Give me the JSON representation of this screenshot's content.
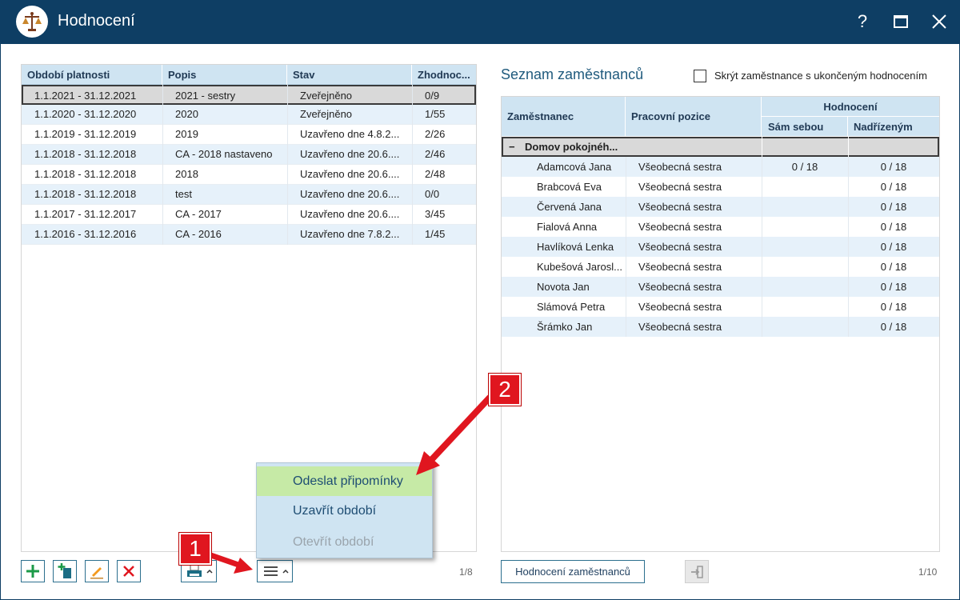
{
  "window": {
    "title": "Hodnocení",
    "help_glyph": "?",
    "logo_icon": "scales-of-justice-icon"
  },
  "left_grid": {
    "columns": [
      "Období platnosti",
      "Popis",
      "Stav",
      "Zhodnoc..."
    ],
    "rows": [
      {
        "period": "1.1.2021 - 31.12.2021",
        "desc": "2021 - sestry",
        "state": "Zveřejněno",
        "eval": "0/9",
        "selected": true
      },
      {
        "period": "1.1.2020 - 31.12.2020",
        "desc": "2020",
        "state": "Zveřejněno",
        "eval": "1/55"
      },
      {
        "period": "1.1.2019 - 31.12.2019",
        "desc": "2019",
        "state": "Uzavřeno dne 4.8.2...",
        "eval": "2/26"
      },
      {
        "period": "1.1.2018 - 31.12.2018",
        "desc": "CA - 2018 nastaveno",
        "state": "Uzavřeno dne 20.6....",
        "eval": "2/46"
      },
      {
        "period": "1.1.2018 - 31.12.2018",
        "desc": "2018",
        "state": "Uzavřeno dne 20.6....",
        "eval": "2/48"
      },
      {
        "period": "1.1.2018 - 31.12.2018",
        "desc": "test",
        "state": "Uzavřeno dne 20.6....",
        "eval": "0/0"
      },
      {
        "period": "1.1.2017 - 31.12.2017",
        "desc": "CA - 2017",
        "state": "Uzavřeno dne 20.6....",
        "eval": "3/45"
      },
      {
        "period": "1.1.2016 - 31.12.2016",
        "desc": "CA - 2016",
        "state": "Uzavřeno dne 7.8.2...",
        "eval": "1/45"
      }
    ],
    "pager": "1/8"
  },
  "toolbar": {
    "add_icon": "plus-icon",
    "copy_icon": "copy-add-icon",
    "edit_icon": "pencil-icon",
    "delete_icon": "delete-x-icon",
    "print_icon": "printer-icon",
    "menu_icon": "hamburger-menu-icon"
  },
  "context_menu": {
    "items": [
      "Odeslat připomínky",
      "Uzavřít období",
      "Otevřít období"
    ]
  },
  "right_panel": {
    "title": "Seznam zaměstnanců",
    "hide_checkbox_label": "Skrýt zaměstnance s ukončeným hodnocením",
    "columns": {
      "employee": "Zaměstnanec",
      "position": "Pracovní pozice",
      "evaluation": "Hodnocení",
      "self": "Sám sebou",
      "superior": "Nadřízeným"
    },
    "group": {
      "toggle": "−",
      "name": "Domov pokojnéh..."
    },
    "rows": [
      {
        "name": "Adamcová Jana",
        "position": "Všeobecná sestra",
        "self": "0 / 18",
        "superior": "0 / 18"
      },
      {
        "name": "Brabcová Eva",
        "position": "Všeobecná sestra",
        "self": "",
        "superior": "0 / 18"
      },
      {
        "name": "Červená Jana",
        "position": "Všeobecná sestra",
        "self": "",
        "superior": "0 / 18"
      },
      {
        "name": "Fialová Anna",
        "position": "Všeobecná sestra",
        "self": "",
        "superior": "0 / 18"
      },
      {
        "name": "Havlíková Lenka",
        "position": "Všeobecná sestra",
        "self": "",
        "superior": "0 / 18"
      },
      {
        "name": "Kubešová Jarosl...",
        "position": "Všeobecná sestra",
        "self": "",
        "superior": "0 / 18"
      },
      {
        "name": "Novota Jan",
        "position": "Všeobecná sestra",
        "self": "",
        "superior": "0 / 18"
      },
      {
        "name": "Slámová Petra",
        "position": "Všeobecná sestra",
        "self": "",
        "superior": "0 / 18"
      },
      {
        "name": "Šrámko Jan",
        "position": "Všeobecná sestra",
        "self": "",
        "superior": "0 / 18"
      }
    ],
    "evaluate_button": "Hodnocení zaměstnanců",
    "export_icon": "export-arrow-icon",
    "pager": "1/10"
  },
  "callouts": {
    "first": "1",
    "second": "2",
    "color": "#e0161f"
  }
}
